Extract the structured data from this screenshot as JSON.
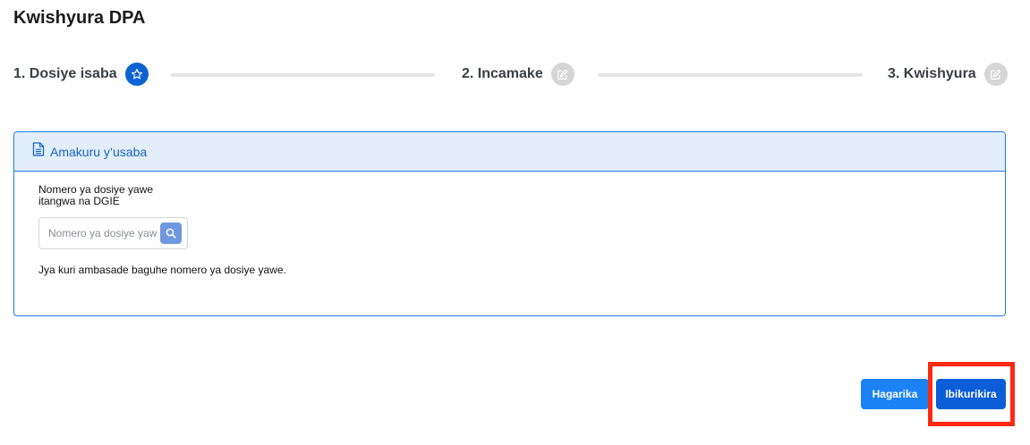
{
  "page": {
    "title": "Kwishyura DPA"
  },
  "steps": [
    {
      "label": "1. Dosiye isaba",
      "icon": "star-icon",
      "state": "active"
    },
    {
      "label": "2. Incamake",
      "icon": "edit-icon",
      "state": "inactive"
    },
    {
      "label": "3. Kwishyura",
      "icon": "edit-icon",
      "state": "inactive"
    }
  ],
  "card": {
    "icon": "document-icon",
    "title": "Amakuru y’usaba",
    "field_label_line1": "Nomero ya dosiye yawe",
    "field_label_line2": "itangwa na DGIE",
    "input_placeholder": "Nomero ya dosiye yawe",
    "input_value": "",
    "search_icon": "search-icon",
    "hint": "Jya kuri ambasade baguhe nomero ya dosiye yawe."
  },
  "actions": {
    "cancel_label": "Hagarika",
    "next_label": "Ibikurikira"
  },
  "colors": {
    "primary": "#0b5ed7",
    "secondary_button": "#1b82f5",
    "highlight": "#ff2a12",
    "card_border": "#1f7be5",
    "card_header_bg": "#e2eef9"
  }
}
